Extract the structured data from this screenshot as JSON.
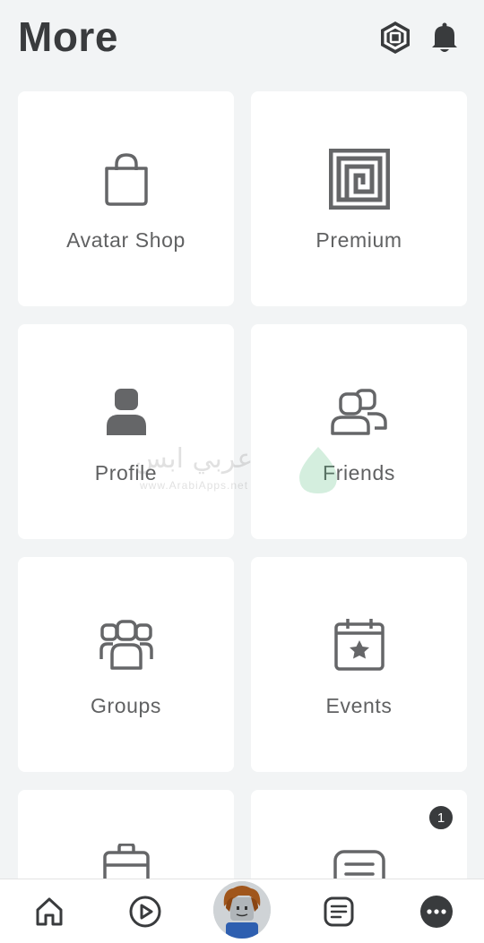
{
  "header": {
    "title": "More",
    "robux_icon": "robux-icon",
    "bell_icon": "bell-icon"
  },
  "tiles": [
    {
      "label": "Avatar Shop",
      "icon": "shopping-bag-icon"
    },
    {
      "label": "Premium",
      "icon": "premium-icon"
    },
    {
      "label": "Profile",
      "icon": "person-icon"
    },
    {
      "label": "Friends",
      "icon": "friends-icon"
    },
    {
      "label": "Groups",
      "icon": "groups-icon"
    },
    {
      "label": "Events",
      "icon": "calendar-star-icon"
    },
    {
      "label": "",
      "icon": "briefcase-icon"
    },
    {
      "label": "",
      "icon": "message-icon",
      "badge": "1"
    }
  ],
  "watermark": {
    "arabic": "عربي ابس",
    "url": "www.ArabiApps.net"
  },
  "bottom_nav": [
    {
      "icon": "home-icon"
    },
    {
      "icon": "play-icon"
    },
    {
      "icon": "avatar-icon"
    },
    {
      "icon": "chat-icon"
    },
    {
      "icon": "more-icon"
    }
  ],
  "colors": {
    "background": "#f2f4f5",
    "tile": "#ffffff",
    "text": "#393b3d",
    "icon": "#656668"
  }
}
